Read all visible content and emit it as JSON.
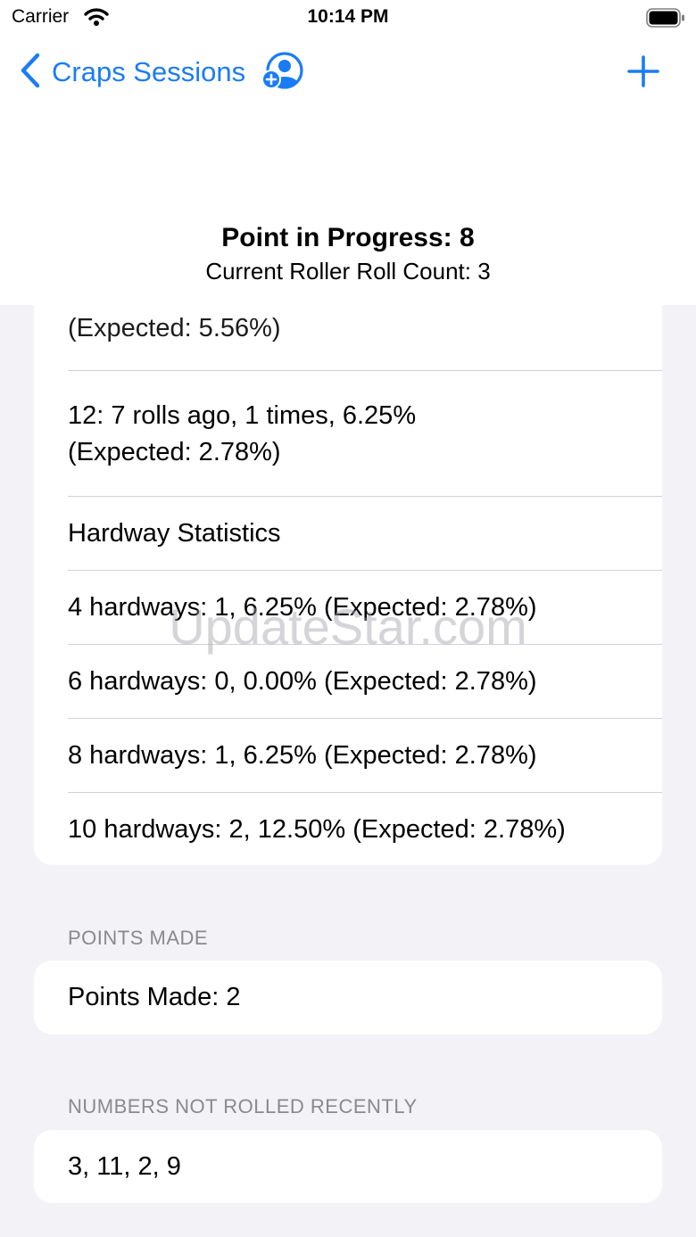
{
  "status_bar": {
    "carrier": "Carrier",
    "time": "10:14 PM"
  },
  "nav": {
    "back_label": "Craps Sessions"
  },
  "header": {
    "point_title": "Point in Progress: 8",
    "roll_count": "Current Roller Roll Count: 3"
  },
  "stats": {
    "partial_row": "(Expected: 5.56%)",
    "row_12_line1": "12: 7 rolls ago, 1 times, 6.25%",
    "row_12_line2": "(Expected: 2.78%)",
    "hardway_title": "Hardway Statistics",
    "hardways": [
      "4 hardways: 1, 6.25% (Expected: 2.78%)",
      "6 hardways: 0, 0.00% (Expected: 2.78%)",
      "8 hardways: 1, 6.25% (Expected: 2.78%)",
      "10 hardways: 2, 12.50% (Expected: 2.78%)"
    ]
  },
  "points_made": {
    "header": "POINTS MADE",
    "value": "Points Made: 2"
  },
  "not_rolled": {
    "header": "NUMBERS NOT ROLLED RECENTLY",
    "value": "3, 11, 2, 9"
  },
  "watermark": "UpdateStar.com",
  "colors": {
    "accent": "#1a7cf5",
    "background": "#f2f2f7",
    "card": "#ffffff",
    "secondary_text": "#8a8a8e"
  },
  "icons": [
    "wifi-icon",
    "battery-icon",
    "chevron-left-icon",
    "person-add-icon",
    "plus-icon"
  ]
}
